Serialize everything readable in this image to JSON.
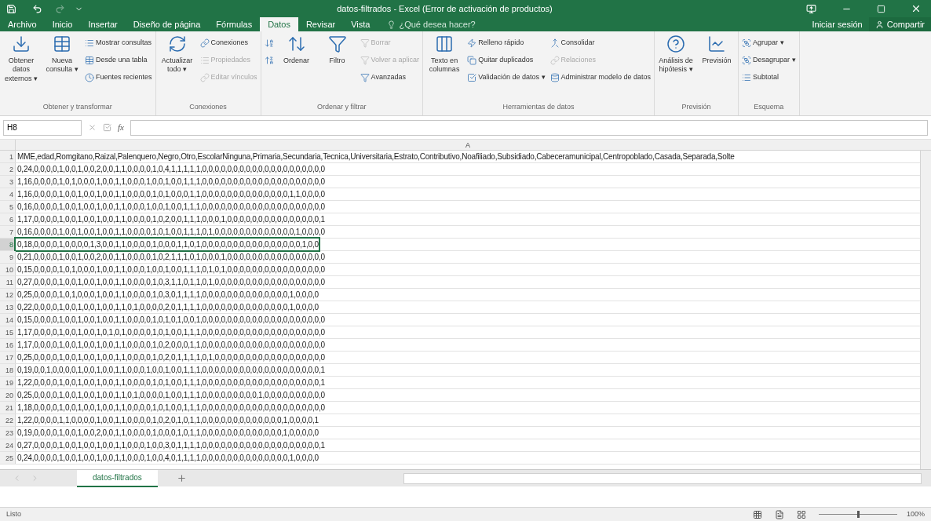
{
  "window": {
    "title": "datos-filtrados - Excel (Error de activación de productos)"
  },
  "tabs": [
    {
      "label": "Archivo",
      "selected": false
    },
    {
      "label": "Inicio",
      "selected": false
    },
    {
      "label": "Insertar",
      "selected": false
    },
    {
      "label": "Diseño de página",
      "selected": false
    },
    {
      "label": "Fórmulas",
      "selected": false
    },
    {
      "label": "Datos",
      "selected": true
    },
    {
      "label": "Revisar",
      "selected": false
    },
    {
      "label": "Vista",
      "selected": false
    }
  ],
  "tell_me": {
    "placeholder": "¿Qué desea hacer?"
  },
  "account": {
    "sign_in": "Iniciar sesión",
    "share": "Compartir"
  },
  "ribbon": [
    {
      "label": "Obtener y transformar",
      "items": [
        {
          "kind": "large",
          "label": "Obtener datos externos ▾",
          "disabled": false
        },
        {
          "kind": "large",
          "label": "Nueva consulta ▾",
          "disabled": false
        },
        {
          "kind": "stack",
          "items": [
            {
              "label": "Mostrar consultas",
              "disabled": false
            },
            {
              "label": "Desde una tabla",
              "disabled": false
            },
            {
              "label": "Fuentes recientes",
              "disabled": false
            }
          ]
        }
      ]
    },
    {
      "label": "Conexiones",
      "items": [
        {
          "kind": "large",
          "label": "Actualizar todo ▾",
          "disabled": false
        },
        {
          "kind": "stack",
          "items": [
            {
              "label": "Conexiones",
              "disabled": false
            },
            {
              "label": "Propiedades",
              "disabled": true
            },
            {
              "label": "Editar vínculos",
              "disabled": true
            }
          ]
        }
      ]
    },
    {
      "label": "Ordenar y filtrar",
      "items": [
        {
          "kind": "stack",
          "items": [
            {
              "disabled": false
            },
            {
              "disabled": false
            }
          ]
        },
        {
          "kind": "large",
          "label": "Ordenar",
          "disabled": false
        },
        {
          "kind": "large",
          "label": "Filtro",
          "disabled": false
        },
        {
          "kind": "stack",
          "items": [
            {
              "label": "Borrar",
              "disabled": true
            },
            {
              "label": "Volver a aplicar",
              "disabled": true
            },
            {
              "label": "Avanzadas",
              "disabled": false
            }
          ]
        }
      ]
    },
    {
      "label": "Herramientas de datos",
      "items": [
        {
          "kind": "large",
          "label": "Texto en columnas",
          "disabled": false
        },
        {
          "kind": "stack",
          "items": [
            {
              "label": "Relleno rápido",
              "disabled": false
            },
            {
              "label": "Quitar duplicados",
              "disabled": false
            },
            {
              "label": "Validación de datos ▾",
              "disabled": false
            }
          ]
        },
        {
          "kind": "stack",
          "items": [
            {
              "label": "Consolidar",
              "disabled": false
            },
            {
              "label": "Relaciones",
              "disabled": true
            },
            {
              "label": "Administrar modelo de datos",
              "disabled": false
            }
          ]
        }
      ]
    },
    {
      "label": "Previsión",
      "items": [
        {
          "kind": "large",
          "label": "Análisis de hipótesis ▾",
          "disabled": false
        },
        {
          "kind": "large",
          "label": "Previsión",
          "disabled": false
        }
      ]
    },
    {
      "label": "Esquema",
      "items": [
        {
          "kind": "stack",
          "items": [
            {
              "label": "Agrupar ▾",
              "disabled": false
            },
            {
              "label": "Desagrupar ▾",
              "disabled": false
            },
            {
              "label": "Subtotal",
              "disabled": false
            }
          ]
        }
      ]
    }
  ],
  "formula_bar": {
    "name_box": "H8",
    "function_label": "fx"
  },
  "column_header": "A",
  "rows": [
    {
      "number": "1",
      "value": "MME,edad,Romgitano,Raizal,Palenquero,Negro,Otro,EscolarNinguna,Primaria,Secundaria,Tecnica,Universitaria,Estrato,Contributivo,Noafiliado,Subsidiado,Cabeceramunicipal,Centropoblado,Casada,Separada,Solte",
      "selected": false
    },
    {
      "number": "2",
      "value": "0,24,0,0,0,0,1,0,0,1,0,0,2,0,0,1,1,0,0,0,0,1,0,4,1,1,1,1,1,0,0,0,0,0,0,0,0,0,0,0,0,0,0,0,0,0,0,0,0",
      "selected": false
    },
    {
      "number": "3",
      "value": "1,16,0,0,0,0,1,0,1,0,0,0,1,0,0,1,1,0,0,0,1,0,0,1,0,0,1,1,1,0,0,0,0,0,0,0,0,0,0,0,0,0,0,0,0,0,0,0,0",
      "selected": false
    },
    {
      "number": "4",
      "value": "1,16,0,0,0,0,1,0,0,1,0,0,1,0,0,1,1,0,0,0,0,1,0,1,0,0,0,1,1,0,0,0,0,0,0,0,0,0,0,0,0,0,0,1,1,0,0,0,0",
      "selected": false
    },
    {
      "number": "5",
      "value": "0,16,0,0,0,0,1,0,0,1,0,0,1,0,0,1,1,0,0,0,1,0,0,1,0,0,1,1,1,0,0,0,0,0,0,0,0,0,0,0,0,0,0,0,0,0,0,0,0",
      "selected": false
    },
    {
      "number": "6",
      "value": "1,17,0,0,0,0,1,0,0,1,0,0,1,0,0,1,1,0,0,0,0,1,0,2,0,0,1,1,1,0,0,0,1,0,0,0,0,0,0,0,0,0,0,0,0,0,0,0,1",
      "selected": false
    },
    {
      "number": "7",
      "value": "0,16,0,0,0,0,1,0,0,1,0,0,1,0,0,1,1,0,0,0,0,1,0,1,0,0,1,1,1,0,1,0,0,0,0,0,0,0,0,0,0,0,0,0,1,0,0,0,0",
      "selected": false
    },
    {
      "number": "8",
      "value": "0,18,0,0,0,0,1,0,0,0,0,1,3,0,0,1,1,0,0,0,0,1,0,0,0,1,1,0,1,0,0,0,0,0,0,0,0,0,0,0,0,0,0,0,0,1,0,0",
      "selected": true
    },
    {
      "number": "9",
      "value": "0,21,0,0,0,0,1,0,0,1,0,0,2,0,0,1,1,0,0,0,0,1,0,2,1,1,1,0,1,0,0,0,1,0,0,0,0,0,0,0,0,0,0,0,0,0,0,0,0",
      "selected": false
    },
    {
      "number": "10",
      "value": "0,15,0,0,0,0,1,0,1,0,0,0,1,0,0,1,1,0,0,0,1,0,0,1,0,0,1,1,1,0,1,0,1,0,0,0,0,0,0,0,0,0,0,0,0,0,0,0,0",
      "selected": false
    },
    {
      "number": "11",
      "value": "0,27,0,0,0,0,1,0,0,1,0,0,1,0,0,1,1,0,0,0,0,1,0,3,1,1,0,1,1,0,1,0,0,0,0,0,0,0,0,0,0,0,0,0,0,0,0,0,0",
      "selected": false
    },
    {
      "number": "12",
      "value": "0,25,0,0,0,0,1,0,1,0,0,0,1,0,0,1,1,0,0,0,0,1,0,3,0,1,1,1,1,0,0,0,0,0,0,0,0,0,0,0,0,0,0,1,0,0,0,0",
      "selected": false
    },
    {
      "number": "13",
      "value": "0,22,0,0,0,0,1,0,0,1,0,0,1,0,0,1,1,0,1,0,0,0,0,2,0,1,1,1,1,0,0,0,0,0,0,0,0,0,0,0,0,0,0,1,0,0,0,0",
      "selected": false
    },
    {
      "number": "14",
      "value": "0,15,0,0,0,0,1,0,0,1,0,0,1,0,0,1,1,0,0,0,0,1,0,1,0,1,0,0,1,0,0,0,0,0,0,0,0,0,0,0,0,0,0,0,0,0,0,0,0",
      "selected": false
    },
    {
      "number": "15",
      "value": "1,17,0,0,0,0,1,0,0,1,0,0,1,0,1,0,1,0,0,0,0,1,0,1,0,0,1,1,1,0,0,0,0,0,0,0,0,0,0,0,0,0,0,0,0,0,0,0,0",
      "selected": false
    },
    {
      "number": "16",
      "value": "1,17,0,0,0,0,1,0,0,1,0,0,1,0,0,1,1,0,0,0,0,1,0,2,0,0,0,1,1,0,0,0,0,0,0,0,0,0,0,0,0,0,0,0,0,0,0,0,0",
      "selected": false
    },
    {
      "number": "17",
      "value": "0,25,0,0,0,0,1,0,0,1,0,0,1,0,0,1,1,0,0,0,0,1,0,2,0,1,1,1,1,0,1,0,0,0,0,0,0,0,0,0,0,0,0,0,0,0,0,0,0",
      "selected": false
    },
    {
      "number": "18",
      "value": "0,19,0,0,1,0,0,0,0,1,0,0,1,0,0,1,1,0,0,0,1,0,0,1,0,0,1,1,1,0,0,0,0,0,0,0,0,0,0,0,0,0,0,0,0,0,0,0,1",
      "selected": false
    },
    {
      "number": "19",
      "value": "1,22,0,0,0,0,1,0,0,1,0,0,1,0,0,1,1,0,0,0,0,1,0,1,0,0,1,1,1,0,0,0,0,0,0,0,0,0,0,0,0,0,0,0,0,0,0,0,1",
      "selected": false
    },
    {
      "number": "20",
      "value": "0,25,0,0,0,0,1,0,0,1,0,0,1,0,0,1,1,0,1,0,0,0,0,1,0,0,1,1,1,0,0,0,0,0,0,0,0,0,1,0,0,0,0,0,0,0,0,0,0",
      "selected": false
    },
    {
      "number": "21",
      "value": "1,18,0,0,0,0,1,0,0,1,0,0,1,0,0,1,1,0,0,0,0,1,0,1,0,0,1,1,1,0,0,0,0,0,0,0,0,0,0,0,0,0,0,0,0,0,0,0,0",
      "selected": false
    },
    {
      "number": "22",
      "value": "1,22,0,0,0,0,1,1,0,0,0,0,1,0,0,1,1,0,0,0,0,1,0,2,0,1,0,1,1,0,0,0,0,0,0,0,0,0,0,0,0,0,1,0,0,0,0,1",
      "selected": false
    },
    {
      "number": "23",
      "value": "0,19,0,0,0,0,1,0,0,1,0,0,2,0,0,1,1,0,0,0,0,1,0,0,0,1,0,1,1,0,0,0,0,0,0,0,0,0,0,0,0,0,1,0,0,0,0,0",
      "selected": false
    },
    {
      "number": "24",
      "value": "0,27,0,0,0,0,1,0,0,1,0,0,1,0,0,1,1,0,0,0,1,0,0,3,0,1,1,1,1,0,0,0,0,0,0,0,0,0,0,0,0,0,0,0,0,0,0,0,1",
      "selected": false
    },
    {
      "number": "25",
      "value": "0,24,0,0,0,0,1,0,0,1,0,0,1,0,0,1,1,0,0,0,1,0,0,4,0,1,1,1,1,0,0,0,0,0,0,0,0,0,0,0,0,0,0,1,0,0,0,0",
      "selected": false
    }
  ],
  "sheet_tabs": [
    {
      "label": "datos-filtrados",
      "selected": true
    }
  ],
  "status_bar": {
    "status": "Listo",
    "zoom": "100%",
    "level": 0.5
  }
}
